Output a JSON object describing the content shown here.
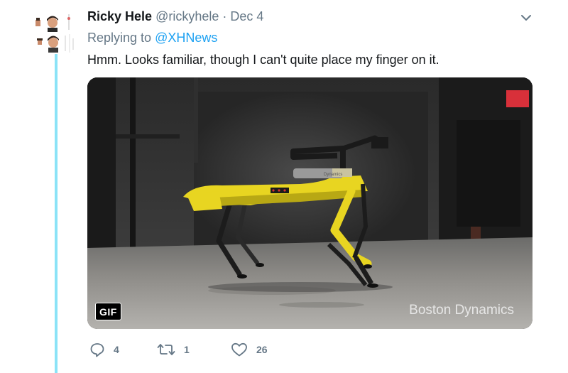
{
  "tweet": {
    "author_name": "Ricky Hele",
    "author_handle": "@rickyhele",
    "separator": "·",
    "date": "Dec 4",
    "replying_prefix": "Replying to",
    "replying_to": "@XHNews",
    "text": "Hmm. Looks familiar, though I can't quite place my finger on it."
  },
  "media": {
    "badge": "GIF",
    "watermark": "Boston Dynamics",
    "robot_label": "Dynamics"
  },
  "actions": {
    "reply_count": "4",
    "retweet_count": "1",
    "like_count": "26"
  },
  "colors": {
    "accent": "#1da1f2",
    "thread_line": "#8be3f7",
    "muted": "#657786",
    "robot": "#e8d521"
  },
  "icons": {
    "reply": "reply-icon",
    "retweet": "retweet-icon",
    "like": "heart-icon",
    "menu": "chevron-down-icon"
  }
}
